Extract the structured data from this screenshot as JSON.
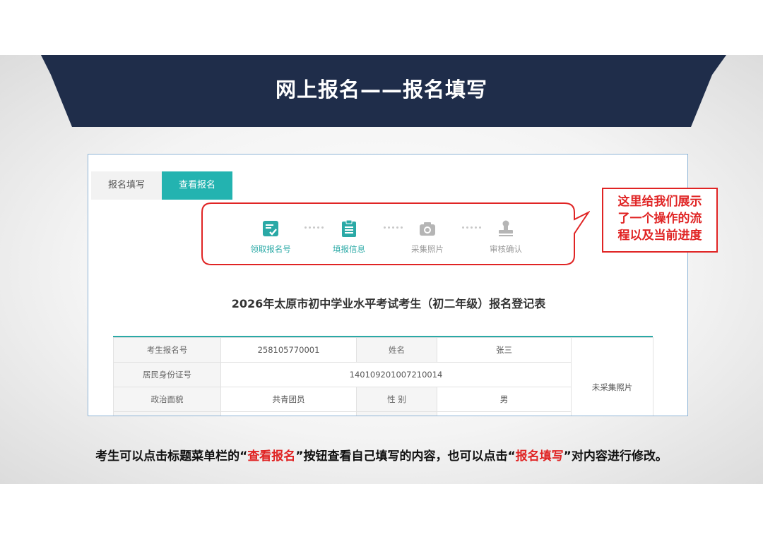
{
  "header": {
    "title": "网上报名——报名填写"
  },
  "tabs": [
    {
      "label": "报名填写",
      "active": false
    },
    {
      "label": "查看报名",
      "active": true
    }
  ],
  "steps": [
    {
      "label": "领取报名号",
      "icon": "clipboard-check-icon",
      "done": true
    },
    {
      "label": "填报信息",
      "icon": "clipboard-list-icon",
      "done": true
    },
    {
      "label": "采集照片",
      "icon": "camera-icon",
      "done": false
    },
    {
      "label": "审核确认",
      "icon": "stamp-icon",
      "done": false
    }
  ],
  "form": {
    "title": "2026年太原市初中学业水平考试考生（初二年级）报名登记表",
    "rows": [
      {
        "l1": "考生报名号",
        "v1": "258105770001",
        "l2": "姓名",
        "v2": "张三"
      },
      {
        "l1": "居民身份证号",
        "v1": "140109201007210014"
      },
      {
        "l1": "政治面貌",
        "v1": "共青团员",
        "l2": "性 别",
        "v2": "男"
      }
    ],
    "photo_text": "未采集照片"
  },
  "callout": {
    "text": "这里给我们展示\n了一个操作的流\n程以及当前进度"
  },
  "caption": {
    "part1": "考生可以点击标题菜单栏的“",
    "hl1": "查看报名",
    "part2": "”按钮查看自己填写的内容，也可以点击“",
    "hl2": "报名填写",
    "part3": "”对内容进行修改。"
  },
  "colors": {
    "banner": "#1f2d4a",
    "accent": "#23b3b0",
    "highlight": "#e02424"
  }
}
